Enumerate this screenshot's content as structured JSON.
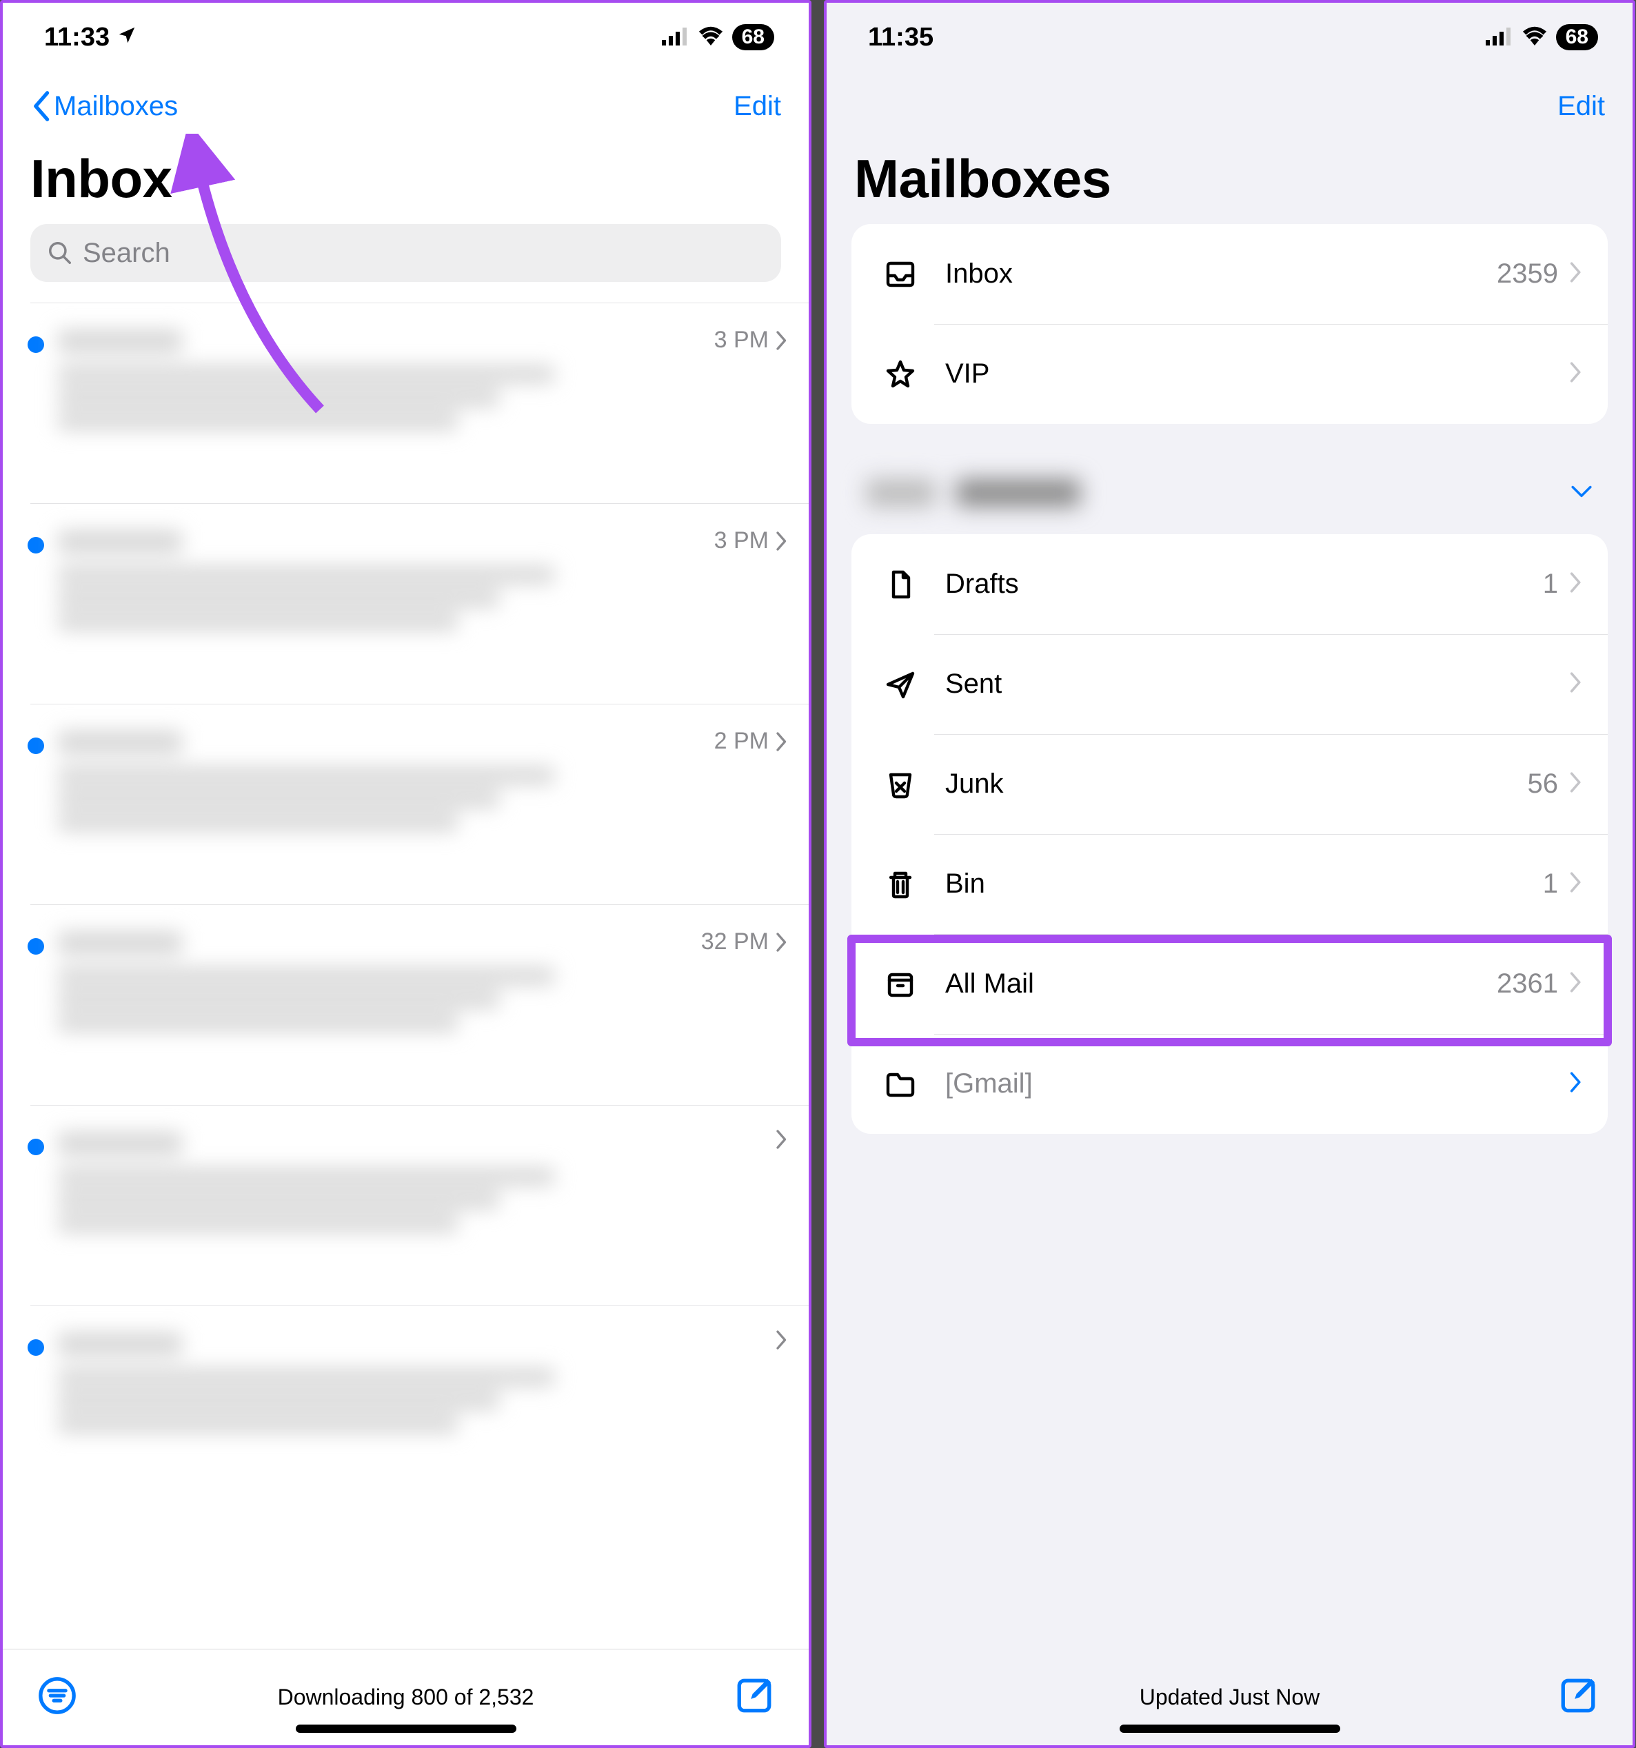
{
  "left": {
    "status": {
      "time": "11:33",
      "battery": "68"
    },
    "nav": {
      "back": "Mailboxes",
      "edit": "Edit"
    },
    "title": "Inbox",
    "search": {
      "placeholder": "Search"
    },
    "messages": [
      {
        "time": "3 PM"
      },
      {
        "time": "3 PM"
      },
      {
        "time": "2 PM"
      },
      {
        "time": "32 PM"
      },
      {
        "time": ""
      },
      {
        "time": ""
      }
    ],
    "toolbar": {
      "status": "Downloading 800 of 2,532"
    }
  },
  "right": {
    "status": {
      "time": "11:35",
      "battery": "68"
    },
    "nav": {
      "edit": "Edit"
    },
    "title": "Mailboxes",
    "group1": [
      {
        "icon": "tray",
        "label": "Inbox",
        "count": "2359"
      },
      {
        "icon": "star",
        "label": "VIP",
        "count": ""
      }
    ],
    "group2": [
      {
        "icon": "doc",
        "label": "Drafts",
        "count": "1"
      },
      {
        "icon": "plane",
        "label": "Sent",
        "count": ""
      },
      {
        "icon": "junk",
        "label": "Junk",
        "count": "56"
      },
      {
        "icon": "trash",
        "label": "Bin",
        "count": "1"
      },
      {
        "icon": "box",
        "label": "All Mail",
        "count": "2361"
      },
      {
        "icon": "folder",
        "label": "[Gmail]",
        "count": ""
      }
    ],
    "toolbar": {
      "status": "Updated Just Now"
    }
  }
}
